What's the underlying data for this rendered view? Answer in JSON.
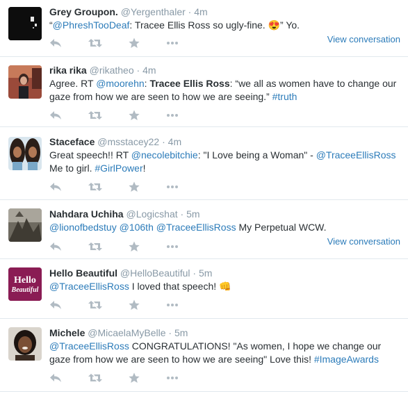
{
  "tweets": [
    {
      "fullname": "Grey Groupon.",
      "username": "@Yergenthaler",
      "time": "4m",
      "text": [
        {
          "t": "“"
        },
        {
          "t": "@PhreshTooDeaf",
          "link": true
        },
        {
          "t": ": Tracee Ellis Ross so ugly-fine. "
        },
        {
          "t": "😍",
          "emoji": true
        },
        {
          "t": "” Yo."
        }
      ],
      "view_conversation": "View conversation"
    },
    {
      "fullname": "rika rika",
      "username": "@rikatheo",
      "time": "4m",
      "text": [
        {
          "t": "Agree. RT "
        },
        {
          "t": "@moorehn",
          "link": true
        },
        {
          "t": ": "
        },
        {
          "t": "Tracee Ellis Ross",
          "bold": true
        },
        {
          "t": ": “we all as women have to change our gaze from how we are seen to how we are seeing.” "
        },
        {
          "t": "#truth",
          "link": true
        }
      ],
      "view_conversation": ""
    },
    {
      "fullname": "Staceface",
      "username": "@msstacey22",
      "time": "4m",
      "text": [
        {
          "t": "Great speech!! RT "
        },
        {
          "t": "@necolebitchie",
          "link": true
        },
        {
          "t": ": \"I Love being a Woman\" - "
        },
        {
          "t": "@TraceeEllisRoss",
          "link": true
        },
        {
          "t": " Me to girl. "
        },
        {
          "t": "#GirlPower",
          "link": true
        },
        {
          "t": "!"
        }
      ],
      "view_conversation": ""
    },
    {
      "fullname": "Nahdara Uchiha",
      "username": "@Logicshat",
      "time": "5m",
      "text": [
        {
          "t": "@lionofbedstuy",
          "link": true
        },
        {
          "t": " "
        },
        {
          "t": "@106th",
          "link": true
        },
        {
          "t": " "
        },
        {
          "t": "@TraceeEllisRoss",
          "link": true
        },
        {
          "t": " My Perpetual WCW."
        }
      ],
      "view_conversation": "View conversation"
    },
    {
      "fullname": "Hello Beautiful",
      "username": "@HelloBeautiful",
      "time": "5m",
      "avatar_text": [
        "Hello",
        "Beautiful"
      ],
      "text": [
        {
          "t": "@TraceeEllisRoss",
          "link": true
        },
        {
          "t": " I loved that speech! "
        },
        {
          "t": "👊",
          "emoji": true
        }
      ],
      "view_conversation": ""
    },
    {
      "fullname": "Michele",
      "username": "@MicaelaMyBelle",
      "time": "5m",
      "text": [
        {
          "t": "@TraceeEllisRoss",
          "link": true
        },
        {
          "t": " CONGRATULATIONS! \"As women, I hope we change our gaze from how we are seen to how we are seeing\" Love this! "
        },
        {
          "t": "#ImageAwards",
          "link": true
        }
      ],
      "view_conversation": ""
    }
  ],
  "action_icons": [
    "reply-icon",
    "retweet-icon",
    "favorite-icon",
    "more-icon"
  ],
  "colors": {
    "link": "#2b7bb9",
    "muted": "#8899a6",
    "action": "#b1bbc3",
    "divider": "#e1e8ed"
  }
}
